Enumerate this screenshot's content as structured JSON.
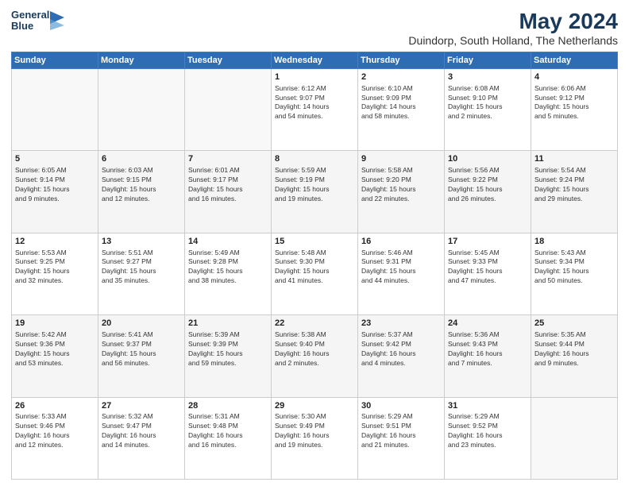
{
  "logo": {
    "line1": "General",
    "line2": "Blue"
  },
  "title": "May 2024",
  "subtitle": "Duindorp, South Holland, The Netherlands",
  "days_header": [
    "Sunday",
    "Monday",
    "Tuesday",
    "Wednesday",
    "Thursday",
    "Friday",
    "Saturday"
  ],
  "weeks": [
    [
      {
        "num": "",
        "info": ""
      },
      {
        "num": "",
        "info": ""
      },
      {
        "num": "",
        "info": ""
      },
      {
        "num": "1",
        "info": "Sunrise: 6:12 AM\nSunset: 9:07 PM\nDaylight: 14 hours\nand 54 minutes."
      },
      {
        "num": "2",
        "info": "Sunrise: 6:10 AM\nSunset: 9:09 PM\nDaylight: 14 hours\nand 58 minutes."
      },
      {
        "num": "3",
        "info": "Sunrise: 6:08 AM\nSunset: 9:10 PM\nDaylight: 15 hours\nand 2 minutes."
      },
      {
        "num": "4",
        "info": "Sunrise: 6:06 AM\nSunset: 9:12 PM\nDaylight: 15 hours\nand 5 minutes."
      }
    ],
    [
      {
        "num": "5",
        "info": "Sunrise: 6:05 AM\nSunset: 9:14 PM\nDaylight: 15 hours\nand 9 minutes."
      },
      {
        "num": "6",
        "info": "Sunrise: 6:03 AM\nSunset: 9:15 PM\nDaylight: 15 hours\nand 12 minutes."
      },
      {
        "num": "7",
        "info": "Sunrise: 6:01 AM\nSunset: 9:17 PM\nDaylight: 15 hours\nand 16 minutes."
      },
      {
        "num": "8",
        "info": "Sunrise: 5:59 AM\nSunset: 9:19 PM\nDaylight: 15 hours\nand 19 minutes."
      },
      {
        "num": "9",
        "info": "Sunrise: 5:58 AM\nSunset: 9:20 PM\nDaylight: 15 hours\nand 22 minutes."
      },
      {
        "num": "10",
        "info": "Sunrise: 5:56 AM\nSunset: 9:22 PM\nDaylight: 15 hours\nand 26 minutes."
      },
      {
        "num": "11",
        "info": "Sunrise: 5:54 AM\nSunset: 9:24 PM\nDaylight: 15 hours\nand 29 minutes."
      }
    ],
    [
      {
        "num": "12",
        "info": "Sunrise: 5:53 AM\nSunset: 9:25 PM\nDaylight: 15 hours\nand 32 minutes."
      },
      {
        "num": "13",
        "info": "Sunrise: 5:51 AM\nSunset: 9:27 PM\nDaylight: 15 hours\nand 35 minutes."
      },
      {
        "num": "14",
        "info": "Sunrise: 5:49 AM\nSunset: 9:28 PM\nDaylight: 15 hours\nand 38 minutes."
      },
      {
        "num": "15",
        "info": "Sunrise: 5:48 AM\nSunset: 9:30 PM\nDaylight: 15 hours\nand 41 minutes."
      },
      {
        "num": "16",
        "info": "Sunrise: 5:46 AM\nSunset: 9:31 PM\nDaylight: 15 hours\nand 44 minutes."
      },
      {
        "num": "17",
        "info": "Sunrise: 5:45 AM\nSunset: 9:33 PM\nDaylight: 15 hours\nand 47 minutes."
      },
      {
        "num": "18",
        "info": "Sunrise: 5:43 AM\nSunset: 9:34 PM\nDaylight: 15 hours\nand 50 minutes."
      }
    ],
    [
      {
        "num": "19",
        "info": "Sunrise: 5:42 AM\nSunset: 9:36 PM\nDaylight: 15 hours\nand 53 minutes."
      },
      {
        "num": "20",
        "info": "Sunrise: 5:41 AM\nSunset: 9:37 PM\nDaylight: 15 hours\nand 56 minutes."
      },
      {
        "num": "21",
        "info": "Sunrise: 5:39 AM\nSunset: 9:39 PM\nDaylight: 15 hours\nand 59 minutes."
      },
      {
        "num": "22",
        "info": "Sunrise: 5:38 AM\nSunset: 9:40 PM\nDaylight: 16 hours\nand 2 minutes."
      },
      {
        "num": "23",
        "info": "Sunrise: 5:37 AM\nSunset: 9:42 PM\nDaylight: 16 hours\nand 4 minutes."
      },
      {
        "num": "24",
        "info": "Sunrise: 5:36 AM\nSunset: 9:43 PM\nDaylight: 16 hours\nand 7 minutes."
      },
      {
        "num": "25",
        "info": "Sunrise: 5:35 AM\nSunset: 9:44 PM\nDaylight: 16 hours\nand 9 minutes."
      }
    ],
    [
      {
        "num": "26",
        "info": "Sunrise: 5:33 AM\nSunset: 9:46 PM\nDaylight: 16 hours\nand 12 minutes."
      },
      {
        "num": "27",
        "info": "Sunrise: 5:32 AM\nSunset: 9:47 PM\nDaylight: 16 hours\nand 14 minutes."
      },
      {
        "num": "28",
        "info": "Sunrise: 5:31 AM\nSunset: 9:48 PM\nDaylight: 16 hours\nand 16 minutes."
      },
      {
        "num": "29",
        "info": "Sunrise: 5:30 AM\nSunset: 9:49 PM\nDaylight: 16 hours\nand 19 minutes."
      },
      {
        "num": "30",
        "info": "Sunrise: 5:29 AM\nSunset: 9:51 PM\nDaylight: 16 hours\nand 21 minutes."
      },
      {
        "num": "31",
        "info": "Sunrise: 5:29 AM\nSunset: 9:52 PM\nDaylight: 16 hours\nand 23 minutes."
      },
      {
        "num": "",
        "info": ""
      }
    ]
  ]
}
